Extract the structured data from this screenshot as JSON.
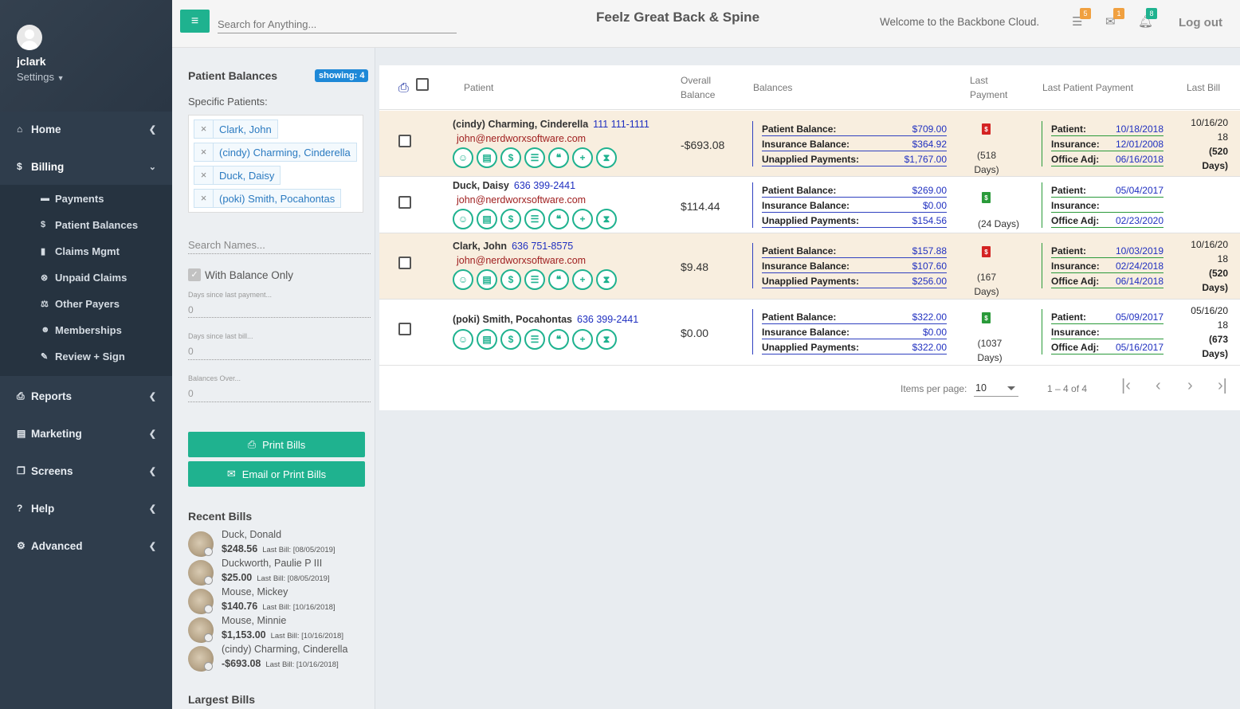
{
  "user": {
    "name": "jclark",
    "settings_label": "Settings"
  },
  "nav": [
    {
      "label": "Home",
      "icon": "home-icon"
    },
    {
      "label": "Billing",
      "icon": "dollar-icon"
    },
    {
      "label": "Reports",
      "icon": "printer-icon"
    },
    {
      "label": "Marketing",
      "icon": "scroll-icon"
    },
    {
      "label": "Screens",
      "icon": "copy-icon"
    },
    {
      "label": "Help",
      "icon": "question-icon"
    },
    {
      "label": "Advanced",
      "icon": "gears-icon"
    }
  ],
  "billing_sub": [
    {
      "label": "Payments",
      "icon": "card-icon"
    },
    {
      "label": "Patient Balances",
      "icon": "dollar-icon"
    },
    {
      "label": "Claims Mgmt",
      "icon": "book-icon"
    },
    {
      "label": "Unpaid Claims",
      "icon": "x-circle-icon"
    },
    {
      "label": "Other Payers",
      "icon": "scale-icon"
    },
    {
      "label": "Memberships",
      "icon": "user-gear-icon"
    },
    {
      "label": "Review + Sign",
      "icon": "edit-icon"
    }
  ],
  "topbar": {
    "search_placeholder": "Search for Anything...",
    "brand": "Feelz Great Back & Spine",
    "welcome": "Welcome to the Backbone Cloud.",
    "badges": {
      "tasks": "5",
      "mail": "1",
      "alerts": "8"
    },
    "badge_colors": {
      "tasks": "#f0a040",
      "mail": "#f0a040",
      "alerts": "#1fb28f"
    },
    "logout": "Log out"
  },
  "filter": {
    "title": "Patient Balances",
    "showing": "showing: 4",
    "specific_label": "Specific Patients:",
    "chips": [
      "Clark, John",
      "(cindy) Charming, Cinderella",
      "Duck, Daisy",
      "(poki) Smith, Pocahontas"
    ],
    "search_names_placeholder": "Search Names...",
    "with_balance_only": "With Balance Only",
    "days_since_payment_label": "Days since last payment...",
    "days_since_payment_value": "0",
    "days_since_bill_label": "Days since last bill...",
    "days_since_bill_value": "0",
    "balances_over_label": "Balances Over...",
    "balances_over_value": "0",
    "print_bills": "Print Bills",
    "email_print_bills": "Email or Print Bills",
    "recent_title": "Recent Bills",
    "largest_title": "Largest Bills"
  },
  "recent_bills": [
    {
      "name": "Duck, Donald",
      "amount": "$248.56",
      "last_bill": "Last Bill: [08/05/2019]"
    },
    {
      "name": "Duckworth, Paulie P III",
      "amount": "$25.00",
      "last_bill": "Last Bill: [08/05/2019]"
    },
    {
      "name": "Mouse, Mickey",
      "amount": "$140.76",
      "last_bill": "Last Bill: [10/16/2018]"
    },
    {
      "name": "Mouse, Minnie",
      "amount": "$1,153.00",
      "last_bill": "Last Bill: [10/16/2018]"
    },
    {
      "name": "(cindy) Charming, Cinderella",
      "amount": "-$693.08",
      "last_bill": "Last Bill: [10/16/2018]"
    }
  ],
  "table": {
    "headers": {
      "patient": "Patient",
      "overall_1": "Overall",
      "overall_2": "Balance",
      "balances": "Balances",
      "last_payment_1": "Last",
      "last_payment_2": "Payment",
      "last_patient_payment": "Last Patient Payment",
      "last_bill": "Last Bill"
    },
    "balance_labels": {
      "patient": "Patient Balance:",
      "insurance": "Insurance Balance:",
      "unapplied": "Unapplied Payments:"
    },
    "lpp_labels": {
      "patient": "Patient:",
      "insurance": "Insurance:",
      "office": "Office Adj:"
    },
    "action_icons": [
      "user-icon",
      "file-icon",
      "dollar-icon",
      "list-icon",
      "chat-icon",
      "plus-circle-icon",
      "hourglass-icon"
    ],
    "rows": [
      {
        "name": "(cindy) Charming, Cinderella",
        "phone": "111 111-1111",
        "email": "john@nerdworxsoftware.com",
        "overall": "-$693.08",
        "patient_balance": "$709.00",
        "insurance_balance": "$364.92",
        "unapplied": "$1,767.00",
        "last_payment_icon": "red-bill-icon",
        "last_payment_days": "(518",
        "last_payment_days2": "Days)",
        "lpp_patient": "10/18/2018",
        "lpp_insurance": "12/01/2008",
        "lpp_office": "06/16/2018",
        "last_bill_1": "10/16/20",
        "last_bill_2": "18",
        "last_bill_3": "(520",
        "last_bill_4": "Days)"
      },
      {
        "name": "Duck, Daisy",
        "phone": "636 399-2441",
        "email": "john@nerdworxsoftware.com",
        "overall": "$114.44",
        "patient_balance": "$269.00",
        "insurance_balance": "$0.00",
        "unapplied": "$154.56",
        "last_payment_icon": "green-bill-icon",
        "last_payment_days": "(24 Days)",
        "last_payment_days2": "",
        "lpp_patient": "05/04/2017",
        "lpp_insurance": "",
        "lpp_office": "02/23/2020",
        "last_bill_1": "",
        "last_bill_2": "",
        "last_bill_3": "",
        "last_bill_4": ""
      },
      {
        "name": "Clark, John",
        "phone": "636 751-8575",
        "email": "john@nerdworxsoftware.com",
        "overall": "$9.48",
        "patient_balance": "$157.88",
        "insurance_balance": "$107.60",
        "unapplied": "$256.00",
        "last_payment_icon": "red-bill-icon",
        "last_payment_days": "(167",
        "last_payment_days2": "Days)",
        "lpp_patient": "10/03/2019",
        "lpp_insurance": "02/24/2018",
        "lpp_office": "06/14/2018",
        "last_bill_1": "10/16/20",
        "last_bill_2": "18",
        "last_bill_3": "(520",
        "last_bill_4": "Days)"
      },
      {
        "name": "(poki) Smith, Pocahontas",
        "phone": "636 399-2441",
        "email": "",
        "overall": "$0.00",
        "patient_balance": "$322.00",
        "insurance_balance": "$0.00",
        "unapplied": "$322.00",
        "last_payment_icon": "green-bill-icon",
        "last_payment_days": "(1037",
        "last_payment_days2": "Days)",
        "lpp_patient": "05/09/2017",
        "lpp_insurance": "",
        "lpp_office": "05/16/2017",
        "last_bill_1": "05/16/20",
        "last_bill_2": "18",
        "last_bill_3": "(673",
        "last_bill_4": "Days)"
      }
    ],
    "pagination": {
      "items_per_page_label": "Items per page:",
      "items_per_page": "10",
      "range": "1 – 4 of 4"
    }
  }
}
